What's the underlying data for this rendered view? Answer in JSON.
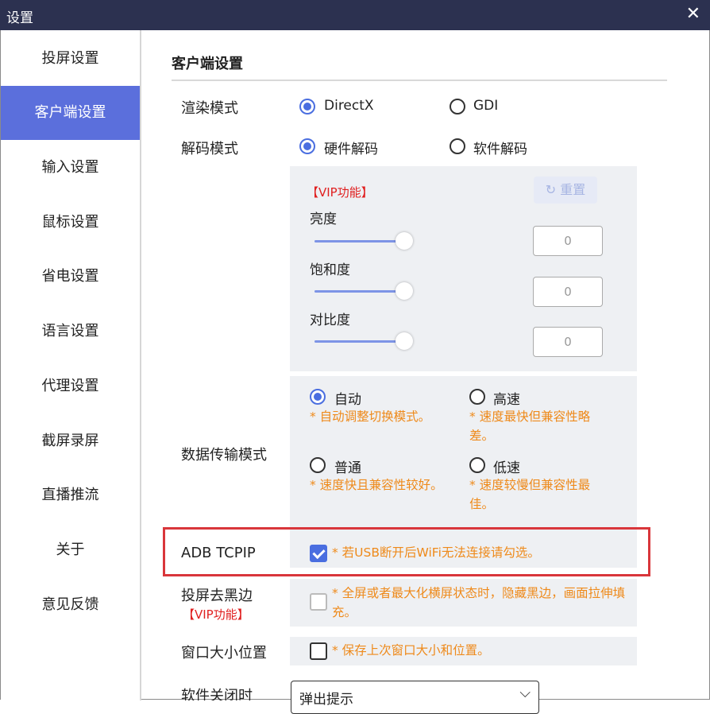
{
  "window": {
    "title": "设置",
    "close_glyph": "✕"
  },
  "sidebar": {
    "items": [
      {
        "label": "投屏设置",
        "active": false
      },
      {
        "label": "客户端设置",
        "active": true
      },
      {
        "label": "输入设置",
        "active": false
      },
      {
        "label": "鼠标设置",
        "active": false
      },
      {
        "label": "省电设置",
        "active": false
      },
      {
        "label": "语言设置",
        "active": false
      },
      {
        "label": "代理设置",
        "active": false
      },
      {
        "label": "截屏录屏",
        "active": false
      },
      {
        "label": "直播推流",
        "active": false
      },
      {
        "label": "关于",
        "active": false
      },
      {
        "label": "意见反馈",
        "active": false
      }
    ]
  },
  "main": {
    "section_title": "客户端设置",
    "render_mode": {
      "label": "渲染模式",
      "options": [
        "DirectX",
        "GDI"
      ],
      "selected": "DirectX"
    },
    "decode_mode": {
      "label": "解码模式",
      "options": [
        "硬件解码",
        "软件解码"
      ],
      "selected": "硬件解码"
    },
    "image_panel": {
      "vip_tag": "【VIP功能】",
      "reset_label": "重置",
      "reset_icon": "refresh-icon",
      "sliders": [
        {
          "label": "亮度",
          "value": "0",
          "level": 1.0
        },
        {
          "label": "饱和度",
          "value": "0",
          "level": 1.0
        },
        {
          "label": "对比度",
          "value": "0",
          "level": 1.0
        }
      ]
    },
    "transfer_mode": {
      "label": "数据传输模式",
      "options": [
        {
          "label": "自动",
          "note": "* 自动调整切换模式。",
          "selected": true
        },
        {
          "label": "高速",
          "note": "* 速度最快但兼容性略差。",
          "selected": false
        },
        {
          "label": "普通",
          "note": "* 速度快且兼容性较好。",
          "selected": false
        },
        {
          "label": "低速",
          "note": "* 速度较慢但兼容性最佳。",
          "selected": false
        }
      ]
    },
    "adb_tcpip": {
      "label": "ADB TCPIP",
      "checked": true,
      "note": "* 若USB断开后WiFi无法连接请勾选。"
    },
    "remove_black": {
      "label": "投屏去黑边",
      "vip_tag": "【VIP功能】",
      "checked": false,
      "note": "* 全屏或者最大化横屏状态时，隐藏黑边，画面拉伸填充。"
    },
    "window_pos": {
      "label": "窗口大小位置",
      "checked": false,
      "note": "* 保存上次窗口大小和位置。"
    },
    "on_close": {
      "label": "软件关闭时",
      "value": "弹出提示"
    }
  },
  "colors": {
    "accent": "#4a6ee0",
    "sidebar_active": "#5b6fdc",
    "titlebar": "#2c3150",
    "note": "#ee8a1b",
    "vip": "#e02020",
    "highlight": "#d9363b"
  }
}
